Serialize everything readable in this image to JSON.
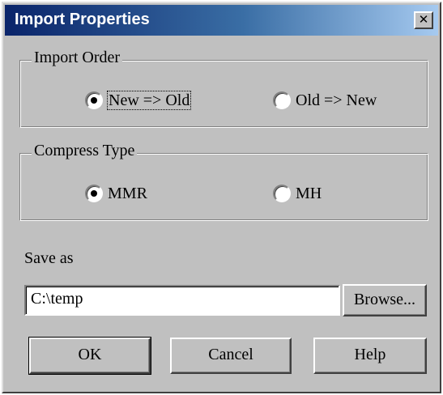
{
  "window": {
    "title": "Import Properties",
    "close_glyph": "✕",
    "title_gradient": [
      "#0a246a",
      "#a6caf0"
    ],
    "face_color": "#c0c0c0"
  },
  "import_order": {
    "label": "Import Order",
    "options": [
      {
        "label": "New => Old",
        "selected": true,
        "focused": true
      },
      {
        "label": "Old => New",
        "selected": false,
        "focused": false
      }
    ]
  },
  "compress_type": {
    "label": "Compress Type",
    "options": [
      {
        "label": "MMR",
        "selected": true
      },
      {
        "label": "MH",
        "selected": false
      }
    ]
  },
  "save_as": {
    "label": "Save as",
    "value": "C:\\temp",
    "browse_label": "Browse..."
  },
  "buttons": {
    "ok": "OK",
    "cancel": "Cancel",
    "help": "Help"
  }
}
